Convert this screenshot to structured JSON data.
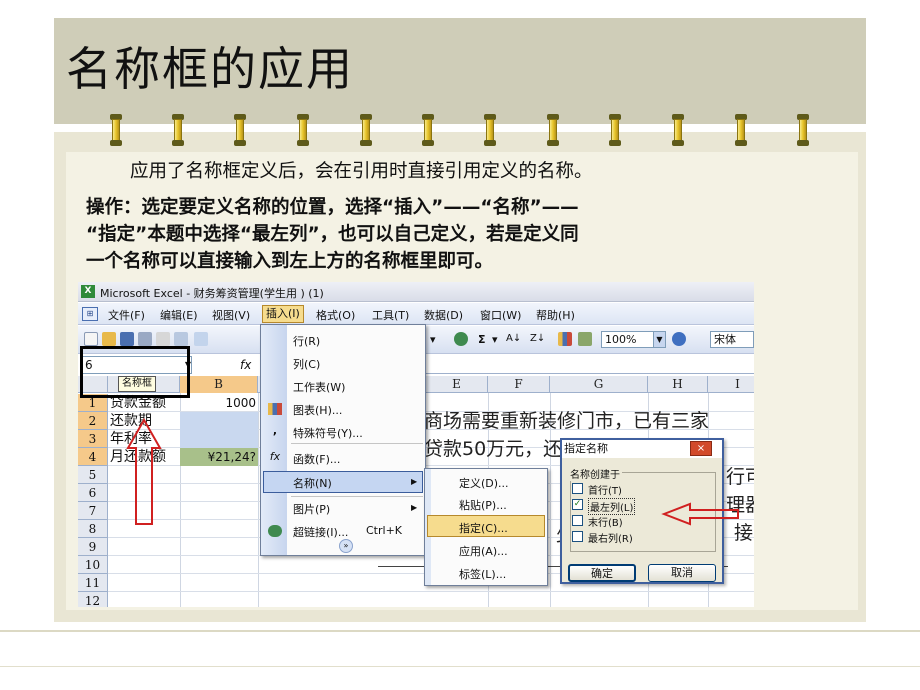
{
  "slide": {
    "title": "名称框的应用",
    "paragraphs": [
      "应用了名称框定义后，会在引用时直接引用定义的名称。",
      "操作：选定要定义名称的位置，选择“插入”——“名称”——",
      "“指定”本题中选择“最左列”，也可以自己定义，若是定义同",
      "一个名称可以直接输入到左上方的名称框里即可。"
    ]
  },
  "excel": {
    "window_title": "Microsoft Excel - 财务筹资管理(学生用 ) (1)",
    "menubar": [
      "文件(F)",
      "编辑(E)",
      "视图(V)",
      "插入(I)",
      "格式(O)",
      "工具(T)",
      "数据(D)",
      "窗口(W)",
      "帮助(H)"
    ],
    "toolbar": {
      "zoom": "100%",
      "font": "宋体",
      "sigma": "Σ"
    },
    "name_box": "6",
    "name_box_tooltip": "名称框",
    "fx": "fx",
    "columns": [
      "B",
      "E",
      "F",
      "G",
      "H",
      "I"
    ],
    "row_numbers": [
      "1",
      "2",
      "3",
      "4",
      "5",
      "6",
      "7",
      "8",
      "9",
      "10",
      "11",
      "12"
    ],
    "cells": {
      "A1": "贷款金额",
      "A2": "还款期",
      "A3": "年利率",
      "A4": "月还款额",
      "B1": "1000",
      "B4": "¥21,24?"
    },
    "sheet_text": [
      "商场需要重新装修门市，已有三家",
      "贷款50万元，还款期10年，年利率",
      "行可",
      "理器",
      "接",
      "少"
    ],
    "insert_menu": {
      "items": [
        "行(R)",
        "列(C)",
        "工作表(W)",
        "图表(H)...",
        "特殊符号(Y)...",
        "函数(F)...",
        "名称(N)",
        "图片(P)",
        "超链接(I)...",
        "Ctrl+K"
      ]
    },
    "name_submenu": {
      "items": [
        "定义(D)...",
        "粘贴(P)...",
        "指定(C)...",
        "应用(A)...",
        "标签(L)..."
      ]
    },
    "dialog": {
      "title": "指定名称",
      "close": "×",
      "group_label": "名称创建于",
      "options": [
        {
          "label": "首行(T)",
          "checked": false
        },
        {
          "label": "最左列(L)",
          "checked": true
        },
        {
          "label": "末行(B)",
          "checked": false
        },
        {
          "label": "最右列(R)",
          "checked": false
        }
      ],
      "ok": "确定",
      "cancel": "取消"
    }
  },
  "colors": {
    "title_band": "#cfcdb8",
    "content_band": "#e9e6d4",
    "arrow_red": "#d02020",
    "menu_highlight": "#f6dc8e"
  }
}
